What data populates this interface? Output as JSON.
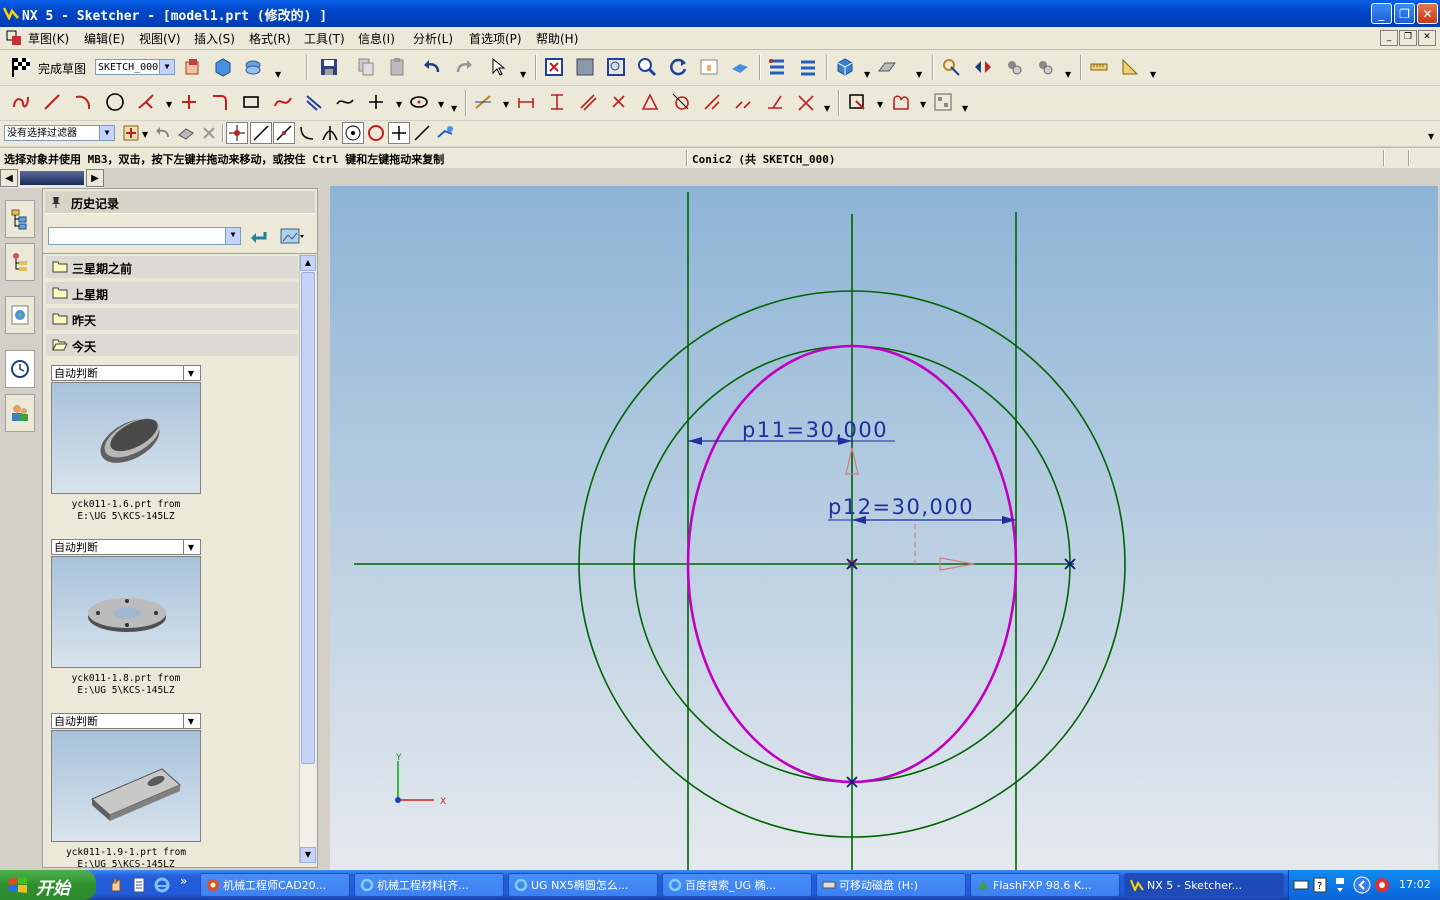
{
  "window": {
    "title": "NX 5 - Sketcher - [model1.prt  (修改的) ]",
    "minimize": "_",
    "restore": "❐",
    "close": "✕"
  },
  "menubar": {
    "items": [
      "草图(K)",
      "编辑(E)",
      "视图(V)",
      "插入(S)",
      "格式(R)",
      "工具(T)",
      "信息(I)",
      "分析(L)",
      "首选项(P)",
      "帮助(H)"
    ]
  },
  "toolbar1": {
    "finish_sketch_label": "完成草图",
    "sketch_name": "SKETCH_000"
  },
  "toolbar3": {
    "filter_value": "没有选择过滤器"
  },
  "status": {
    "prompt": "选择对象并使用 MB3，双击，按下左键并拖动来移动，或按住 Ctrl 键和左键拖动来复制",
    "selection": "Conic2 (共 SKETCH_000)"
  },
  "history_panel": {
    "title": "历史记录",
    "search_value": "",
    "folders": [
      "三星期之前",
      "上星期",
      "昨天",
      "今天"
    ],
    "thumbnails": [
      {
        "mode": "自动判断",
        "caption_line1": "yck011-1.6.prt from",
        "caption_line2": "E:\\UG 5\\KCS-145LZ"
      },
      {
        "mode": "自动判断",
        "caption_line1": "yck011-1.8.prt from",
        "caption_line2": "E:\\UG 5\\KCS-145LZ"
      },
      {
        "mode": "自动判断",
        "caption_line1": "yck011-1.9-1.prt from",
        "caption_line2": "E:\\UG 5\\KCS-145LZ"
      }
    ]
  },
  "viewport": {
    "dim1": "p11=30,000",
    "dim2": "p12=30,000",
    "axis_x": "X",
    "axis_y": "Y",
    "colors": {
      "ellipse": "#c000c0",
      "geometry": "#006400",
      "dimension": "#1f2fa0"
    }
  },
  "taskbar": {
    "start": "开始",
    "tasks": [
      "机械工程师CAD20...",
      "机械工程材料[齐...",
      "UG NX5椭圆怎么...",
      "百度搜索_UG 椭...",
      "可移动磁盘 (H:)",
      "FlashFXP 98.6 K...",
      "NX 5 - Sketcher..."
    ],
    "clock": "17:02"
  }
}
